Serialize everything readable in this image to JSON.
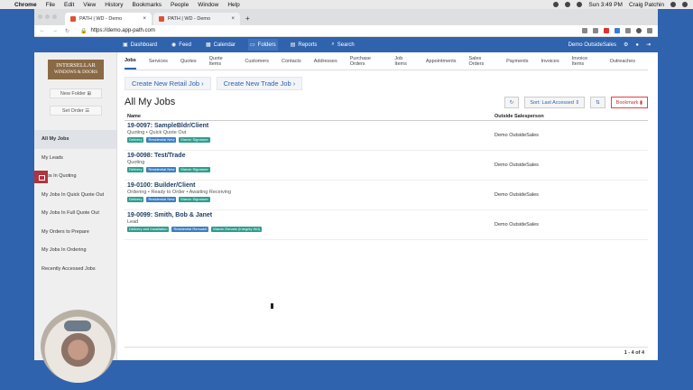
{
  "menubar": {
    "app": "Chrome",
    "items": [
      "File",
      "Edit",
      "View",
      "History",
      "Bookmarks",
      "People",
      "Window",
      "Help"
    ],
    "clock": "Sun 3:49 PM",
    "user": "Craig Patchin"
  },
  "browser": {
    "tabs": [
      {
        "title": "PATH | WD - Demo"
      },
      {
        "title": "PATH | WD - Demo"
      }
    ],
    "url": "https://demo.app-path.com"
  },
  "appnav": {
    "items": [
      {
        "label": "Dashboard",
        "icon": "dashboard-icon"
      },
      {
        "label": "Feed",
        "icon": "globe-icon"
      },
      {
        "label": "Calendar",
        "icon": "calendar-icon"
      },
      {
        "label": "Folders",
        "icon": "folder-icon"
      },
      {
        "label": "Reports",
        "icon": "report-icon"
      },
      {
        "label": "Search",
        "icon": "search-icon"
      }
    ],
    "user": "Demo OutsideSales"
  },
  "sidebar": {
    "logo_line1": "INTERSELLAR",
    "logo_line2": "WINDOWS & DOORS",
    "new_folder": "New Folder",
    "set_order": "Set Order",
    "items": [
      "All My Jobs",
      "My Leads",
      "Jobs In Quoting",
      "My Jobs In Quick Quote Out",
      "My Jobs In Full Quote Out",
      "My Orders to Prepare",
      "My Jobs In Ordering",
      "Recently Accessed Jobs"
    ]
  },
  "subtabs": [
    "Jobs",
    "Services",
    "Quotes",
    "Quote Items",
    "Customers",
    "Contacts",
    "Addresses",
    "Purchase Orders",
    "Job Items",
    "Appointments",
    "Sales Orders",
    "Payments",
    "Invoices",
    "Invoice Items",
    "Outreaches"
  ],
  "create_retail": "Create New Retail Job",
  "create_trade": "Create New Trade Job",
  "page_title": "All My Jobs",
  "sort_label": "Sort: Last Accessed",
  "bookmark_label": "Bookmark",
  "columns": {
    "name": "Name",
    "salesperson": "Outside Salesperson"
  },
  "jobs": [
    {
      "title": "19-0097: SampleBldr/Client",
      "status": "Quoting • Quick Quote Out",
      "tags": [
        "Delivery",
        "Residential New",
        "Marvin Signature"
      ],
      "salesperson": "Demo OutsideSales"
    },
    {
      "title": "19-0098: Test/Trade",
      "status": "Quoting",
      "tags": [
        "Delivery",
        "Residential New",
        "Marvin Signature"
      ],
      "salesperson": "Demo OutsideSales"
    },
    {
      "title": "19-0100: Builder/Client",
      "status": "Ordering • Ready to Order • Awaiting Receiving",
      "tags": [
        "Delivery",
        "Residential New",
        "Marvin Signature"
      ],
      "salesperson": "Demo OutsideSales"
    },
    {
      "title": "19-0099: Smith, Bob & Janet",
      "status": "Lead",
      "tags": [
        "Delivery and Installation",
        "Residential Remodel",
        "Marvin Elevate (Integrity Wd)"
      ],
      "salesperson": "Demo OutsideSales"
    }
  ],
  "pager": "1 - 4 of 4"
}
